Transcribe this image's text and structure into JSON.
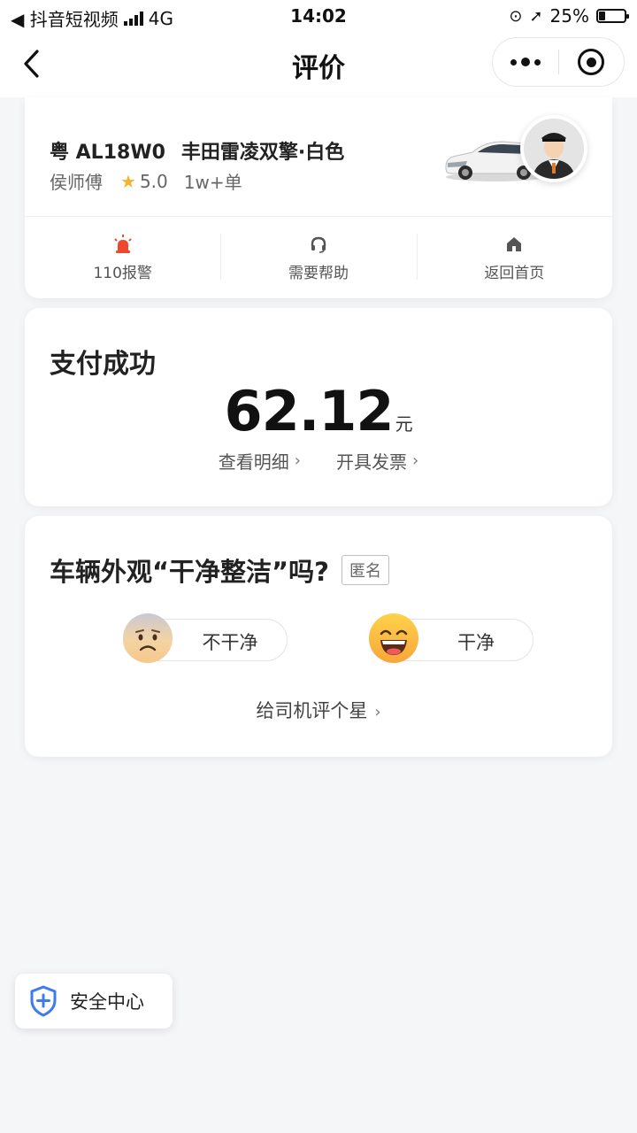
{
  "status_bar": {
    "carrier_back": "◀ 抖音短视频",
    "network": "4G",
    "time": "14:02",
    "battery_percent": "25%",
    "battery_level": 0.25
  },
  "nav": {
    "title": "评价",
    "back_icon": "chevron-left-icon",
    "more_icon": "more-dots-icon",
    "close_icon": "target-circle-icon"
  },
  "driver": {
    "plate": "粤 AL18W0",
    "car": "丰田雷凌双擎·白色",
    "name": "侯师傅",
    "rating": "5.0",
    "orders": "1w+单"
  },
  "quick_actions": [
    {
      "label": "110报警",
      "icon": "alarm-siren-icon",
      "color": "#f0482f"
    },
    {
      "label": "需要帮助",
      "icon": "headset-icon",
      "color": "#555555"
    },
    {
      "label": "返回首页",
      "icon": "home-icon",
      "color": "#555555"
    }
  ],
  "payment": {
    "title": "支付成功",
    "amount": "62.12",
    "unit": "元",
    "detail_link": "查看明细",
    "invoice_link": "开具发票"
  },
  "rating": {
    "question": "车辆外观“干净整洁”吗?",
    "anon_tag": "匿名",
    "bad_label": "不干净",
    "good_label": "干净",
    "rate_driver": "给司机评个星"
  },
  "safety": {
    "label": "安全中心",
    "icon": "shield-plus-icon",
    "accent": "#3d7bf0"
  }
}
